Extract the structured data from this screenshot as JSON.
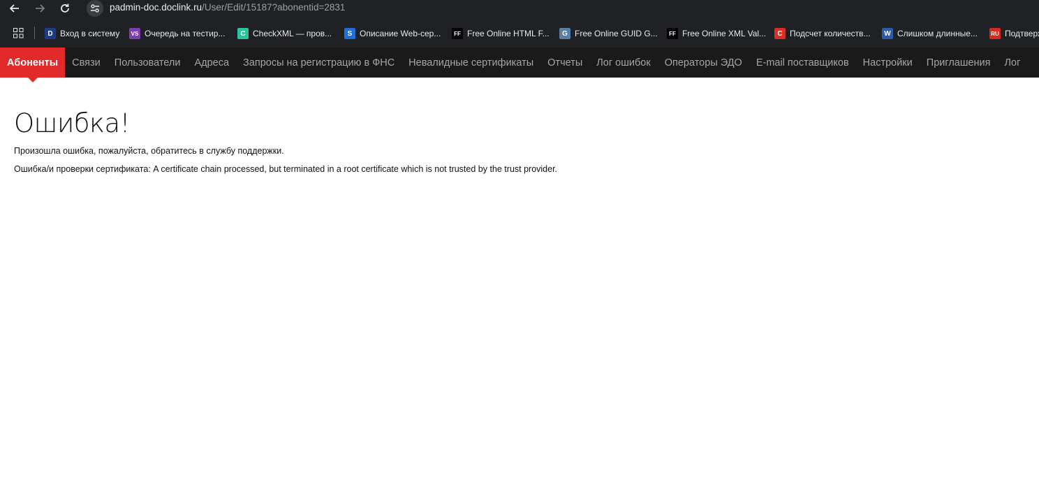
{
  "browser": {
    "url_host": "padmin-doc.doclink.ru",
    "url_path": "/User/Edit/15187?abonentid=2831",
    "bookmarks": [
      {
        "label": "Вход в систему",
        "icon": "D",
        "color": "#1e3a8a"
      },
      {
        "label": "Очередь на тестир...",
        "icon": "VS",
        "color": "#7b3fb3"
      },
      {
        "label": "CheckXML — пров...",
        "icon": "C",
        "color": "#2ac4a0"
      },
      {
        "label": "Описание Web-сер...",
        "icon": "S",
        "color": "#1e6fd9"
      },
      {
        "label": "Free Online HTML F...",
        "icon": "FF",
        "color": "#000000"
      },
      {
        "label": "Free Online GUID G...",
        "icon": "G",
        "color": "#5a7fa8"
      },
      {
        "label": "Free Online XML Val...",
        "icon": "FF",
        "color": "#000000"
      },
      {
        "label": "Подсчет количеств...",
        "icon": "C",
        "color": "#d93025"
      },
      {
        "label": "Слишком длинные...",
        "icon": "W",
        "color": "#2b5cab"
      },
      {
        "label": "Подтверж",
        "icon": "RU",
        "color": "#d52b1e"
      }
    ]
  },
  "nav": {
    "items": [
      {
        "label": "Абоненты",
        "active": true
      },
      {
        "label": "Связи"
      },
      {
        "label": "Пользователи"
      },
      {
        "label": "Адреса"
      },
      {
        "label": "Запросы на регистрацию в ФНС"
      },
      {
        "label": "Невалидные сертификаты"
      },
      {
        "label": "Отчеты"
      },
      {
        "label": "Лог ошибок"
      },
      {
        "label": "Операторы ЭДО"
      },
      {
        "label": "E-mail поставщиков"
      },
      {
        "label": "Настройки"
      },
      {
        "label": "Приглашения"
      },
      {
        "label": "Лог"
      }
    ],
    "active_color": "#e22a2a"
  },
  "content": {
    "title": "Ошибка!",
    "message": "Произошла ошибка, пожалуйста, обратитесь в службу поддержки.",
    "detail": "Ошибка/и проверки сертификата: A certificate chain processed, but terminated in a root certificate which is not trusted by the trust provider."
  }
}
